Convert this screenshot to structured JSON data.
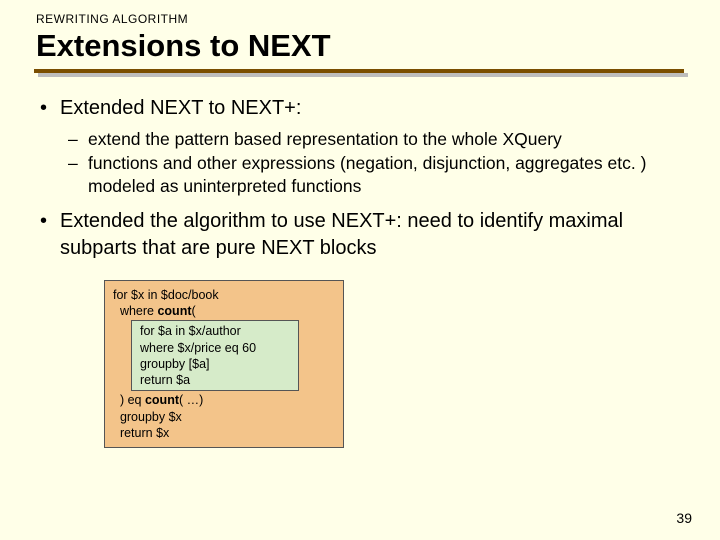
{
  "header": {
    "kicker": "REWRITING ALGORITHM",
    "title": "Extensions to NEXT"
  },
  "bullets": {
    "b1": "Extended NEXT to NEXT+:",
    "b1_sub1": "extend the pattern based representation to the whole XQuery",
    "b1_sub2": "functions and other expressions (negation, disjunction, aggregates etc. ) modeled as uninterpreted functions",
    "b2": "Extended the algorithm to use NEXT+: need to identify maximal subparts that are pure NEXT blocks"
  },
  "code": {
    "outer": {
      "l1": "for $x in $doc/book",
      "l2_pre": "  where ",
      "l2_b": "count",
      "l2_post": "(",
      "l7_pre": "  ) eq ",
      "l7_b": "count",
      "l7_post": "( …)",
      "l8": "  groupby $x",
      "l9": "  return $x"
    },
    "inner": {
      "i1": "for $a in $x/author",
      "i2": "where $x/price eq 60",
      "i3": "groupby [$a]",
      "i4": "return $a"
    }
  },
  "page": "39"
}
